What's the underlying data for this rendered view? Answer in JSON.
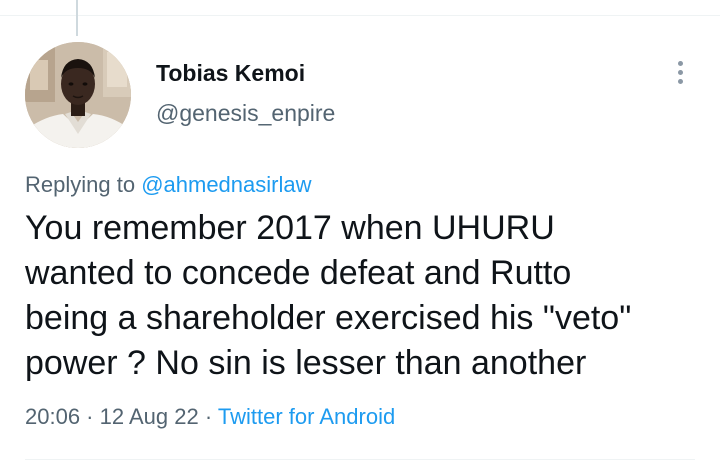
{
  "author": {
    "name": "Tobias Kemoi",
    "handle": "@genesis_enpire"
  },
  "reply": {
    "prefix": "Replying to ",
    "to": "@ahmednasirlaw"
  },
  "tweet": {
    "text": "You remember 2017 when UHURU\nwanted to concede defeat and Rutto\nbeing a shareholder exercised his  \"veto\"\npower ? No sin is lesser than another"
  },
  "meta": {
    "time": "20:06",
    "sep1": " · ",
    "date": "12 Aug 22",
    "sep2": " · ",
    "source": "Twitter for Android"
  },
  "icons": {
    "more": "more-vertical-icon"
  },
  "colors": {
    "link": "#1d9bf0",
    "secondary_text": "#536471",
    "primary_text": "#0f1419"
  }
}
